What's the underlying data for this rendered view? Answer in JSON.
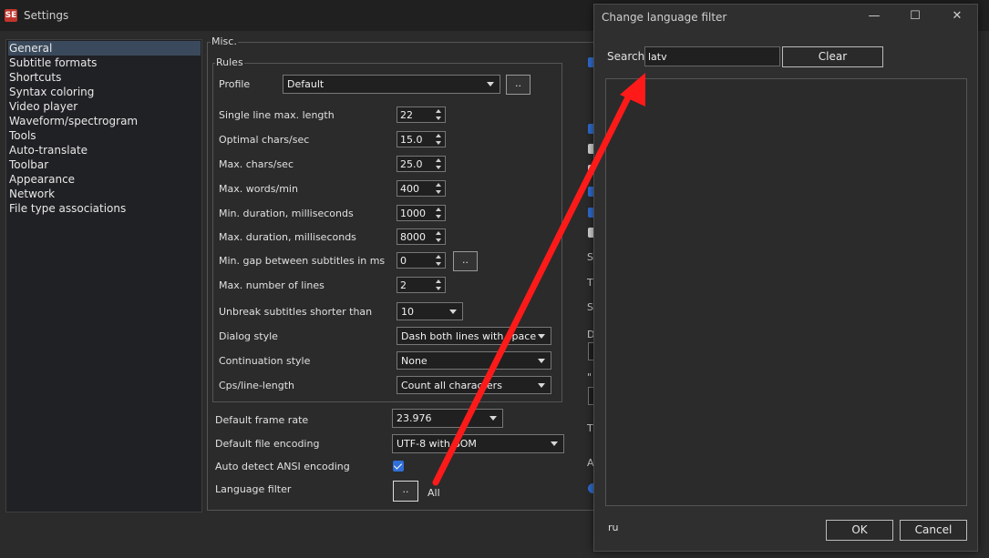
{
  "window": {
    "title": "Settings",
    "logo_text": "SE"
  },
  "sidebar": {
    "items": [
      {
        "label": "General",
        "selected": true
      },
      {
        "label": "Subtitle formats"
      },
      {
        "label": "Shortcuts"
      },
      {
        "label": "Syntax coloring"
      },
      {
        "label": "Video player"
      },
      {
        "label": "Waveform/spectrogram"
      },
      {
        "label": "Tools"
      },
      {
        "label": "Auto-translate"
      },
      {
        "label": "Toolbar"
      },
      {
        "label": "Appearance"
      },
      {
        "label": "Network"
      },
      {
        "label": "File type associations"
      }
    ]
  },
  "misc": {
    "title": "Misc.",
    "rules": {
      "title": "Rules",
      "profile": {
        "label": "Profile",
        "value": "Default",
        "button": ".."
      },
      "single_line_max_length": {
        "label": "Single line max. length",
        "value": "22"
      },
      "optimal_chars_sec": {
        "label": "Optimal chars/sec",
        "value": "15.0"
      },
      "max_chars_sec": {
        "label": "Max. chars/sec",
        "value": "25.0"
      },
      "max_words_min": {
        "label": "Max. words/min",
        "value": "400"
      },
      "min_duration": {
        "label": "Min. duration, milliseconds",
        "value": "1000"
      },
      "max_duration": {
        "label": "Max. duration, milliseconds",
        "value": "8000"
      },
      "min_gap": {
        "label": "Min. gap between subtitles in ms",
        "value": "0",
        "button": ".."
      },
      "max_lines": {
        "label": "Max. number of lines",
        "value": "2"
      },
      "unbreak": {
        "label": "Unbreak subtitles shorter than",
        "value": "10"
      },
      "dialog_style": {
        "label": "Dialog style",
        "value": "Dash both lines with space"
      },
      "continuation_style": {
        "label": "Continuation style",
        "value": "None"
      },
      "cps_line_length": {
        "label": "Cps/line-length",
        "value": "Count all characters"
      }
    },
    "default_frame_rate": {
      "label": "Default frame rate",
      "value": "23.976"
    },
    "default_file_encoding": {
      "label": "Default file encoding",
      "value": "UTF-8 with BOM"
    },
    "auto_detect_ansi": {
      "label": "Auto detect ANSI encoding",
      "checked": true
    },
    "language_filter": {
      "label": "Language filter",
      "button": "..",
      "value": "All"
    }
  },
  "right_column_peek": {
    "letters": [
      "S",
      "T",
      "S",
      "D",
      "\"",
      "T",
      "A"
    ]
  },
  "dialog": {
    "title": "Change language filter",
    "controls": {
      "minimize": "—",
      "maximize": "☐",
      "close": "✕"
    },
    "search": {
      "label": "Search",
      "value": "latv",
      "placeholder": ""
    },
    "clear_label": "Clear",
    "selected_code": "ru",
    "ok_label": "OK",
    "cancel_label": "Cancel"
  },
  "colors": {
    "accent_check": "#2f6fd6",
    "annotation_arrow": "#ff1a1a",
    "selection": "#3a4a5c"
  }
}
